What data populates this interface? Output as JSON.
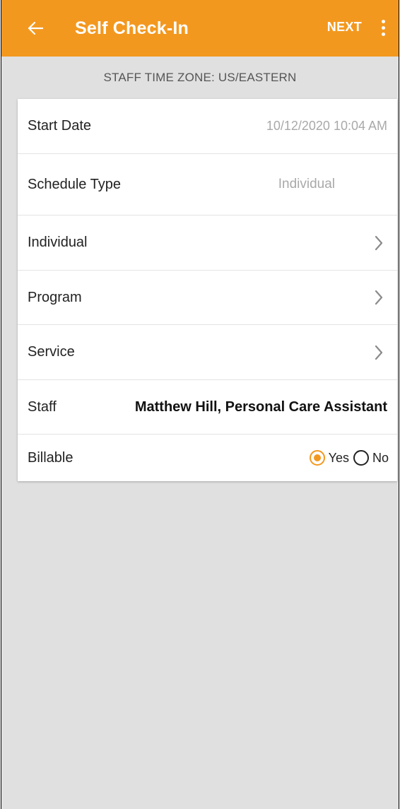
{
  "colors": {
    "accent": "#f3981f",
    "background": "#e0e0e0",
    "card": "#ffffff",
    "muted_text": "#a9a9a9"
  },
  "appbar": {
    "back_icon": "arrow-left-icon",
    "title": "Self Check-In",
    "next_label": "NEXT",
    "more_icon": "more-vertical-icon"
  },
  "timezone_banner": "STAFF TIME ZONE: US/EASTERN",
  "form": {
    "start_date": {
      "label": "Start Date",
      "value": "10/12/2020 10:04 AM"
    },
    "schedule_type": {
      "label": "Schedule Type",
      "value": "Individual"
    },
    "individual": {
      "label": "Individual",
      "icon": "chevron-right-icon"
    },
    "program": {
      "label": "Program",
      "icon": "chevron-right-icon"
    },
    "service": {
      "label": "Service",
      "icon": "chevron-right-icon"
    },
    "staff": {
      "label": "Staff",
      "value": "Matthew Hill, Personal Care Assistant"
    },
    "billable": {
      "label": "Billable",
      "options": [
        {
          "label": "Yes",
          "selected": true
        },
        {
          "label": "No",
          "selected": false
        }
      ]
    }
  }
}
